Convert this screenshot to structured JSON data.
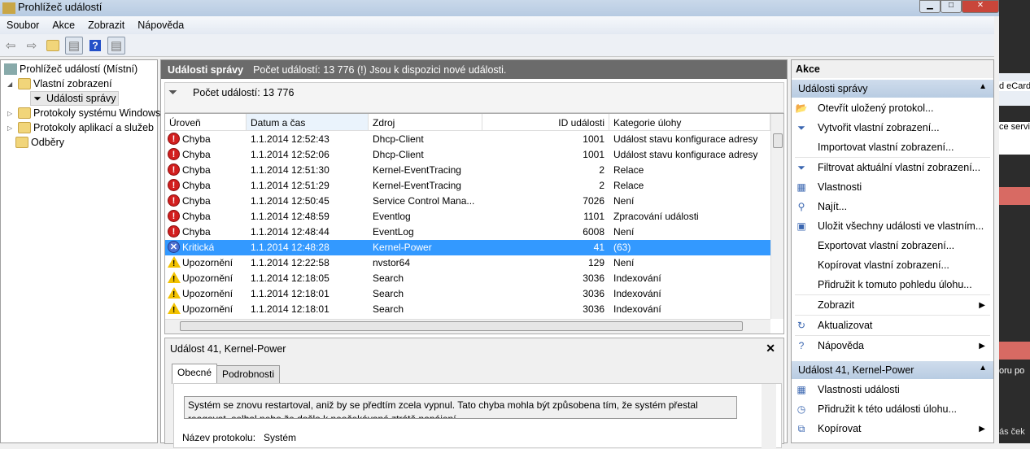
{
  "window": {
    "title": "Prohlížeč událostí"
  },
  "menu": [
    "Soubor",
    "Akce",
    "Zobrazit",
    "Nápověda"
  ],
  "tree": {
    "root": "Prohlížeč událostí (Místní)",
    "custom_views": "Vlastní zobrazení",
    "admin_events": "Události správy",
    "windows_logs": "Protokoly systému Windows",
    "app_logs": "Protokoly aplikací a služeb",
    "subscriptions": "Odběry"
  },
  "center": {
    "title": "Události správy",
    "info": "Počet událostí: 13 776 (!) Jsou k dispozici nové události.",
    "count": "Počet událostí: 13 776"
  },
  "columns": [
    "Úroveň",
    "Datum a čas",
    "Zdroj",
    "ID události",
    "Kategorie úlohy"
  ],
  "rows": [
    {
      "level": "Chyba",
      "type": "err",
      "date": "1.1.2014 12:52:43",
      "source": "Dhcp-Client",
      "id": "1001",
      "category": "Událost stavu konfigurace adresy"
    },
    {
      "level": "Chyba",
      "type": "err",
      "date": "1.1.2014 12:52:06",
      "source": "Dhcp-Client",
      "id": "1001",
      "category": "Událost stavu konfigurace adresy"
    },
    {
      "level": "Chyba",
      "type": "err",
      "date": "1.1.2014 12:51:30",
      "source": "Kernel-EventTracing",
      "id": "2",
      "category": "Relace"
    },
    {
      "level": "Chyba",
      "type": "err",
      "date": "1.1.2014 12:51:29",
      "source": "Kernel-EventTracing",
      "id": "2",
      "category": "Relace"
    },
    {
      "level": "Chyba",
      "type": "err",
      "date": "1.1.2014 12:50:45",
      "source": "Service Control Mana...",
      "id": "7026",
      "category": "Není"
    },
    {
      "level": "Chyba",
      "type": "err",
      "date": "1.1.2014 12:48:59",
      "source": "Eventlog",
      "id": "1101",
      "category": "Zpracování události"
    },
    {
      "level": "Chyba",
      "type": "err",
      "date": "1.1.2014 12:48:44",
      "source": "EventLog",
      "id": "6008",
      "category": "Není"
    },
    {
      "level": "Kritická",
      "type": "crit",
      "date": "1.1.2014 12:48:28",
      "source": "Kernel-Power",
      "id": "41",
      "category": "(63)",
      "selected": true
    },
    {
      "level": "Upozornění",
      "type": "warn",
      "date": "1.1.2014 12:22:58",
      "source": "nvstor64",
      "id": "129",
      "category": "Není"
    },
    {
      "level": "Upozornění",
      "type": "warn",
      "date": "1.1.2014 12:18:05",
      "source": "Search",
      "id": "3036",
      "category": "Indexování"
    },
    {
      "level": "Upozornění",
      "type": "warn",
      "date": "1.1.2014 12:18:01",
      "source": "Search",
      "id": "3036",
      "category": "Indexování"
    },
    {
      "level": "Upozornění",
      "type": "warn",
      "date": "1.1.2014 12:18:01",
      "source": "Search",
      "id": "3036",
      "category": "Indexování"
    }
  ],
  "detail": {
    "title": "Událost 41, Kernel-Power",
    "tabs": [
      "Obecné",
      "Podrobnosti"
    ],
    "description": "Systém se znovu restartoval, aniž by se předtím zcela vypnul. Tato chyba mohla být způsobena tím, že systém přestal reagovat, selhal nebo že došlo k neočekávané ztrátě napájení.",
    "log_label": "Název protokolu:",
    "log_value": "Systém"
  },
  "actions": {
    "title": "Akce",
    "section1": "Události správy",
    "items1": [
      {
        "label": "Otevřít uložený protokol...",
        "icon": "open-folder-icon"
      },
      {
        "label": "Vytvořit vlastní zobrazení...",
        "icon": "filter-icon"
      },
      {
        "label": "Importovat vlastní zobrazení...",
        "icon": ""
      },
      {
        "label": "Filtrovat aktuální vlastní zobrazení...",
        "icon": "filter-icon"
      },
      {
        "label": "Vlastnosti",
        "icon": "properties-icon"
      },
      {
        "label": "Najít...",
        "icon": "binoculars-icon"
      },
      {
        "label": "Uložit všechny události ve vlastním...",
        "icon": "save-icon"
      },
      {
        "label": "Exportovat vlastní zobrazení...",
        "icon": ""
      },
      {
        "label": "Kopírovat vlastní zobrazení...",
        "icon": ""
      },
      {
        "label": "Přidružit k tomuto pohledu úlohu...",
        "icon": ""
      },
      {
        "label": "Zobrazit",
        "icon": "",
        "submenu": true
      },
      {
        "label": "Aktualizovat",
        "icon": "refresh-icon"
      },
      {
        "label": "Nápověda",
        "icon": "help-icon",
        "submenu": true
      }
    ],
    "section2": "Událost 41, Kernel-Power",
    "items2": [
      {
        "label": "Vlastnosti události",
        "icon": "properties-icon"
      },
      {
        "label": "Přidružit k této události úlohu...",
        "icon": "task-icon"
      },
      {
        "label": "Kopírovat",
        "icon": "copy-icon",
        "submenu": true
      }
    ]
  },
  "background": [
    "d eCard",
    "ce servi",
    "oru po",
    "ás ček"
  ]
}
